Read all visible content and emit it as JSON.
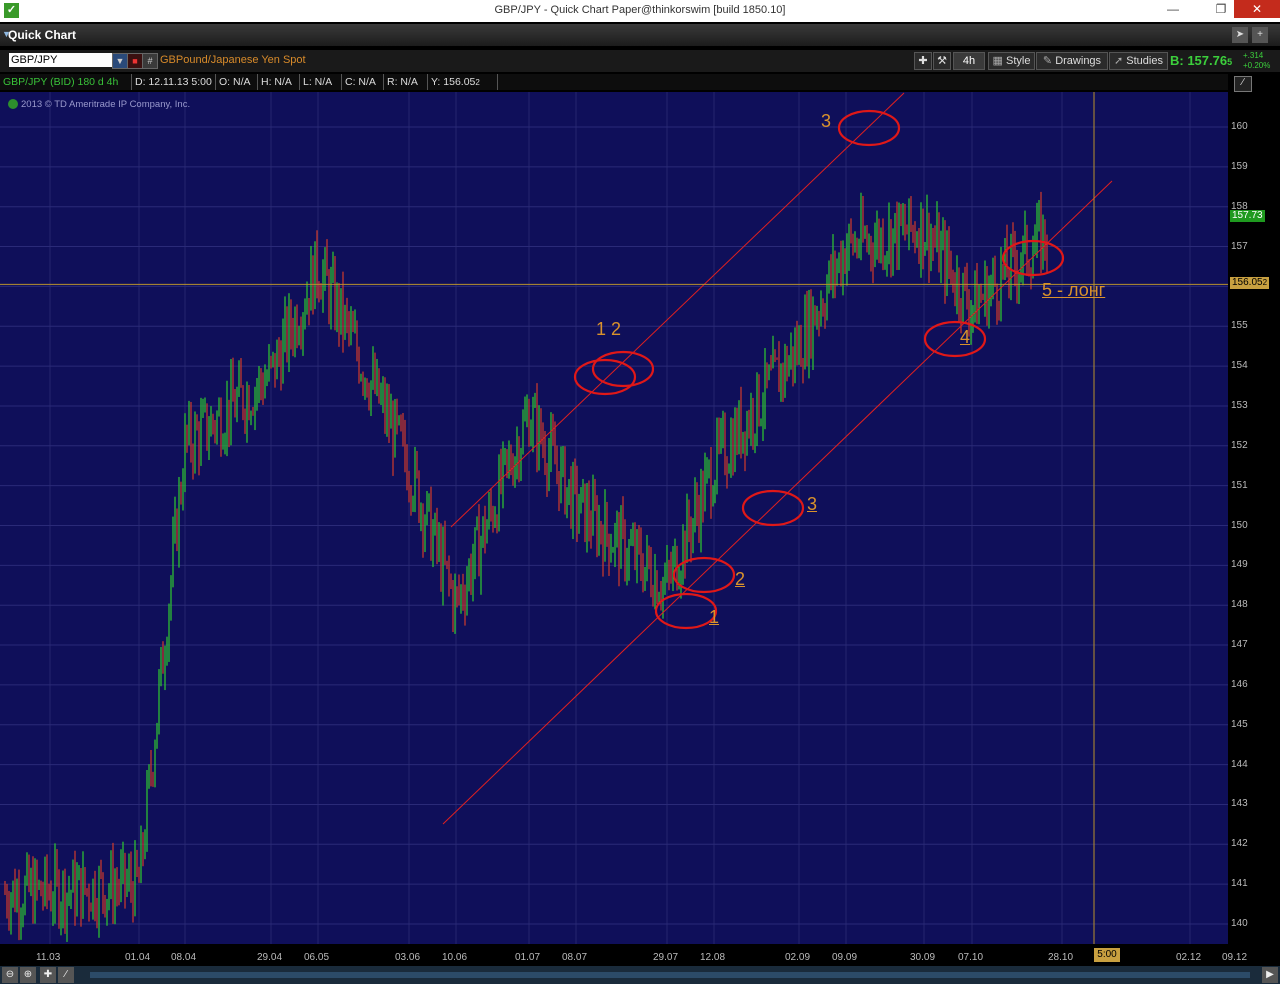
{
  "window": {
    "title": "GBP/JPY - Quick Chart Paper@thinkorswim [build 1850.10]",
    "logo_text": "✓"
  },
  "quick_chart": {
    "label": "Quick Chart"
  },
  "toolbar": {
    "symbol": "GBP/JPY",
    "description": "GBPound/Japanese Yen Spot",
    "timeframe": "4h",
    "style_label": "Style",
    "drawings_label": "Drawings",
    "studies_label": "Studies",
    "bid": "B: 157.76",
    "bid_small": "5",
    "change_abs": "+.314",
    "change_pct": "+0.20%"
  },
  "info": {
    "symbol": "GBP/JPY (BID) 180 d 4h",
    "date": "D: 12.11.13 5:00",
    "open": "O: N/A",
    "high": "H: N/A",
    "low": "L: N/A",
    "close": "C: N/A",
    "range": "R: N/A",
    "y": "Y: 156.05",
    "y_small": "2"
  },
  "copyright": "2013 © TD Ameritrade IP Company, Inc.",
  "price_tags": {
    "last": "157.73",
    "cursor": "156.05",
    "cursor_small": "2"
  },
  "time_marker": "5:00",
  "colors": {
    "plot_bg": "#0f0f5a",
    "up": "#2ecc2e",
    "down": "#d33b2a",
    "drawing": "#e02020",
    "annotation": "#d9922c"
  },
  "chart_data": {
    "type": "candlestick",
    "symbol": "GBP/JPY",
    "ylim": [
      139.5,
      161
    ],
    "y_ticks": [
      "160",
      "159",
      "158",
      "157",
      "156",
      "155",
      "154",
      "153",
      "152",
      "151",
      "150",
      "149",
      "148",
      "147",
      "146",
      "145",
      "144",
      "143",
      "142",
      "141",
      "140"
    ],
    "x_ticks": [
      "11.03",
      "01.04",
      "08.04",
      "29.04",
      "06.05",
      "03.06",
      "10.06",
      "01.07",
      "08.07",
      "29.07",
      "12.08",
      "02.09",
      "09.09",
      "30.09",
      "07.10",
      "28.10",
      "02.12",
      "09.12"
    ],
    "price_path": [
      {
        "x": "11.03",
        "y": 140.8
      },
      {
        "x": "01.04",
        "y": 141.0
      },
      {
        "x": "08.04",
        "y": 152.0
      },
      {
        "x": "29.04",
        "y": 153.8
      },
      {
        "x": "06.05",
        "y": 156.5
      },
      {
        "x": "03.06",
        "y": 151.5
      },
      {
        "x": "10.06",
        "y": 148.0
      },
      {
        "x": "01.07",
        "y": 152.8
      },
      {
        "x": "08.07",
        "y": 150.5
      },
      {
        "x": "29.07",
        "y": 148.5
      },
      {
        "x": "12.08",
        "y": 151.5
      },
      {
        "x": "02.09",
        "y": 154.5
      },
      {
        "x": "09.09",
        "y": 157.0
      },
      {
        "x": "30.09",
        "y": 157.5
      },
      {
        "x": "07.10",
        "y": 155.5
      },
      {
        "x": "28.10",
        "y": 157.7
      }
    ],
    "horizontal_line": 156.05,
    "annotations": [
      "3",
      "1 2",
      "3",
      "2",
      "1",
      "4",
      "5 - лонг"
    ]
  }
}
